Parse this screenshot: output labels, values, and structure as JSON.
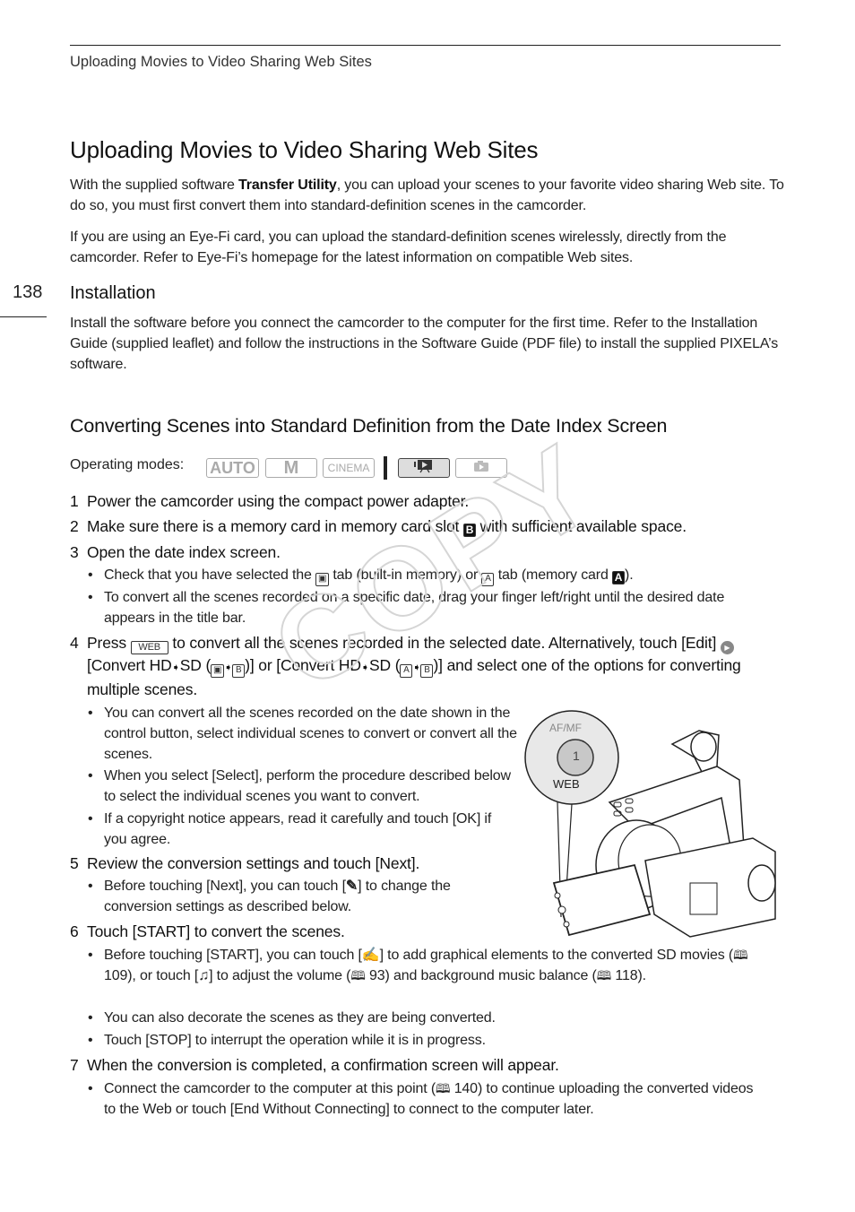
{
  "running_head": "Uploading Movies to Video Sharing Web Sites",
  "page_number": "138",
  "title": "Uploading Movies to Video Sharing Web Sites",
  "intro": {
    "p1_before": "With the supplied software ",
    "p1_bold": "Transfer Utility",
    "p1_after": ", you can upload your scenes to your favorite video sharing Web site. To do so, you must first convert them into standard-definition scenes in the camcorder.",
    "p2": "If you are using an Eye-Fi card, you can upload the standard-definition scenes wirelessly, directly from the camcorder. Refer to Eye-Fi’s homepage for the latest information on compatible Web sites."
  },
  "installation": {
    "heading": "Installation",
    "body": "Install the software before you connect the camcorder to the computer for the first time. Refer to the Installation Guide (supplied leaflet) and follow the instructions in the Software Guide (PDF file) to install the supplied PIXELA’s software."
  },
  "converting": {
    "heading": "Converting Scenes into Standard Definition from the Date Index Screen",
    "modes_label": "Operating modes:",
    "modes": [
      {
        "label": "AUTO",
        "active": false
      },
      {
        "label": "M",
        "active": false
      },
      {
        "label": "CINEMA",
        "active": false
      },
      {
        "label": "playback-movie-icon",
        "active": true
      },
      {
        "label": "playback-photo-icon",
        "active": false
      }
    ],
    "steps": [
      {
        "num": "1",
        "text": "Power the camcorder using the compact power adapter."
      },
      {
        "num": "2",
        "text_a": "Make sure there is a memory card in memory card slot ",
        "slot": "B",
        "text_b": " with sufficient available space."
      },
      {
        "num": "3",
        "text": "Open the date index screen.",
        "bullets": [
          {
            "a": "Check that you have selected the ",
            "b": " tab (built-in memory) or ",
            "icon_a": "A",
            "c": " tab (memory card ",
            "slot": "A",
            "d": ")."
          },
          {
            "text": "To convert all the scenes recorded on a specific date, drag your finger left/right until the desired date appears in the title bar."
          }
        ]
      },
      {
        "num": "4",
        "a": "Press ",
        "web": "WEB",
        "b": " to convert all the scenes recorded in the selected date. Alternatively, touch [Edit] ",
        "c": " [Convert HD",
        "d": "SD (",
        "e": ")] or [Convert HD",
        "f": "SD (",
        "g": ")] and select one of the options for converting multiple scenes.",
        "icon_a": "A",
        "icon_b": "B",
        "bullets": [
          "You can convert all the scenes recorded on the date shown in the control button, select individual scenes to convert or convert all the scenes.",
          "When you select [Select], perform the procedure described below to select the individual scenes you want to convert.",
          "If a copyright notice appears, read it carefully and touch [OK] if you agree."
        ]
      },
      {
        "num": "5",
        "text": "Review the conversion settings and touch [Next].",
        "bullets": [
          {
            "a": "Before touching [Next], you can touch [",
            "b": "] to change the conversion settings as described below."
          }
        ]
      },
      {
        "num": "6",
        "text": "Touch [START] to convert the scenes.",
        "bullets": [
          {
            "a": "Before touching [START], you can touch [",
            "b": "] to add graphical elements to the converted SD movies (",
            "ref1": "109",
            "c": "), or touch [",
            "d": "] to adjust the volume (",
            "ref2": "93",
            "e": ") and background music balance (",
            "ref3": "118",
            "f": ")."
          },
          {
            "text": "You can also decorate the scenes as they are being converted."
          },
          {
            "text": "Touch [STOP] to interrupt the operation while it is in progress."
          }
        ]
      },
      {
        "num": "7",
        "text": "When the conversion is completed, a confirmation screen will appear.",
        "bullets": [
          {
            "a": "Connect the camcorder to the computer at this point (",
            "ref": "140",
            "b": ") to continue uploading the converted videos to the Web or touch [End Without Connecting] to connect to the computer later."
          }
        ]
      }
    ]
  },
  "illustration": {
    "button_top_label": "AF/MF",
    "button_number": "1",
    "button_bottom_label": "WEB"
  },
  "watermark": "COPY",
  "bullet_char": "•",
  "arrow_char": "➧",
  "book_char": "🕮"
}
